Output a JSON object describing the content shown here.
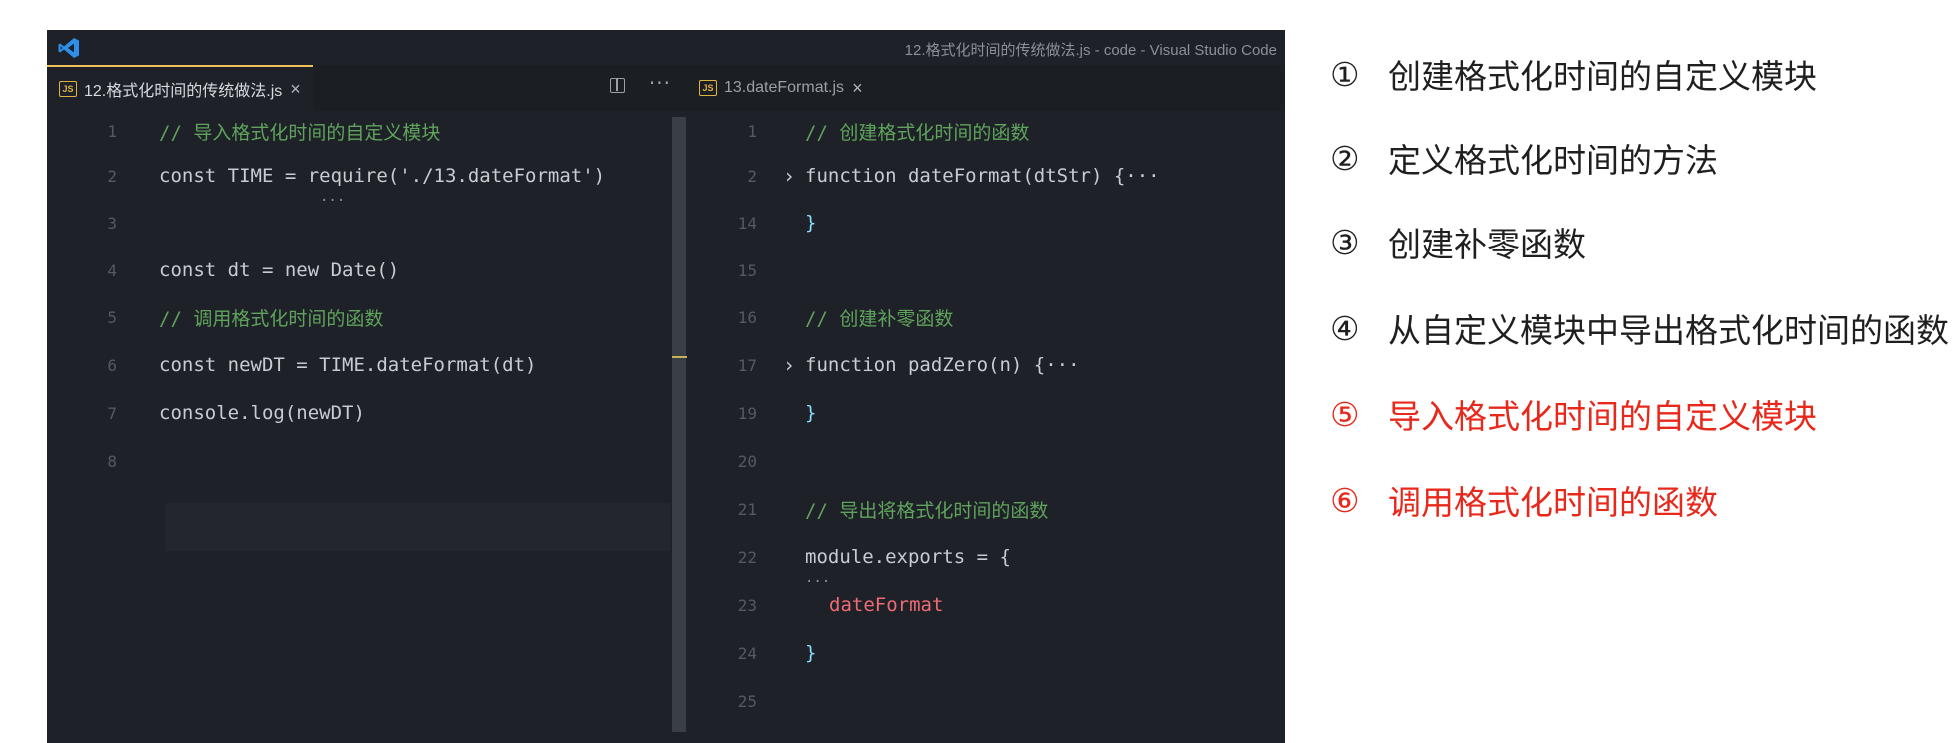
{
  "window": {
    "title": "12.格式化时间的传统做法.js - code - Visual Studio Code"
  },
  "left_editor": {
    "tab_label": "12.格式化时间的传统做法.js",
    "tab_icon": "JS",
    "lines": [
      {
        "n": "1",
        "text": "// 导入格式化时间的自定义模块"
      },
      {
        "n": "2",
        "text": "const TIME = require('./13.dateFormat')"
      },
      {
        "n": "3",
        "text": ""
      },
      {
        "n": "4",
        "text": "const dt = new Date()"
      },
      {
        "n": "5",
        "text": "// 调用格式化时间的函数"
      },
      {
        "n": "6",
        "text": "const newDT = TIME.dateFormat(dt)"
      },
      {
        "n": "7",
        "text": "console.log(newDT)"
      },
      {
        "n": "8",
        "text": ""
      }
    ]
  },
  "right_editor": {
    "tab_label": "13.dateFormat.js",
    "tab_icon": "JS",
    "lines": [
      {
        "n": "1",
        "text": "// 创建格式化时间的函数"
      },
      {
        "n": "2",
        "text": "function dateFormat(dtStr) {···"
      },
      {
        "n": "14",
        "text": "}"
      },
      {
        "n": "15",
        "text": ""
      },
      {
        "n": "16",
        "text": "// 创建补零函数"
      },
      {
        "n": "17",
        "text": "function padZero(n) {···"
      },
      {
        "n": "19",
        "text": "}"
      },
      {
        "n": "20",
        "text": ""
      },
      {
        "n": "21",
        "text": "// 导出将格式化时间的函数"
      },
      {
        "n": "22",
        "text": "module.exports = {"
      },
      {
        "n": "23",
        "text": "dateFormat"
      },
      {
        "n": "24",
        "text": "}"
      },
      {
        "n": "25",
        "text": ""
      }
    ]
  },
  "steps": [
    {
      "num": "①",
      "text": "创建格式化时间的自定义模块",
      "color": "#1f1f1f"
    },
    {
      "num": "②",
      "text": "定义格式化时间的方法",
      "color": "#1f1f1f"
    },
    {
      "num": "③",
      "text": "创建补零函数",
      "color": "#1f1f1f"
    },
    {
      "num": "④",
      "text": "从自定义模块中导出格式化时间的函数",
      "color": "#1f1f1f"
    },
    {
      "num": "⑤",
      "text": "导入格式化时间的自定义模块",
      "color": "#e8281b"
    },
    {
      "num": "⑥",
      "text": "调用格式化时间的函数",
      "color": "#e8281b"
    }
  ],
  "colors": {
    "editor_bg": "#1e2127",
    "comment": "#5fa35c",
    "keyword": "#c792ea",
    "variable": "#ef6b73",
    "function": "#82aaff",
    "string": "#c3e88d",
    "highlight_step": "#e8281b",
    "tab_accent": "#f0c15a"
  },
  "icons": {
    "app": "vscode-logo-icon",
    "file": "js-file-icon",
    "split": "split-editor-icon",
    "more": "more-actions-icon",
    "close": "close-icon",
    "fold": "chevron-right-icon"
  }
}
